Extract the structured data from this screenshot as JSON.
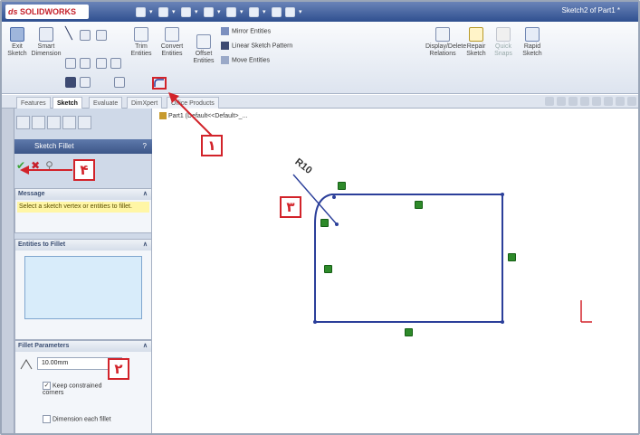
{
  "app": {
    "logo_text": "SOLIDWORKS",
    "document_title": "Sketch2 of Part1 *"
  },
  "ribbon": {
    "exit_sketch": "Exit Sketch",
    "smart_dimension": "Smart Dimension",
    "trim_entities": "Trim Entities",
    "convert_entities": "Convert Entities",
    "offset_entities": "Offset Entities",
    "mirror_entities": "Mirror Entities",
    "linear_sketch_pattern": "Linear Sketch Pattern",
    "move_entities": "Move Entities",
    "display_delete_relations": "Display/Delete Relations",
    "repair_sketch": "Repair Sketch",
    "quick_snaps": "Quick Snaps",
    "rapid_sketch": "Rapid Sketch"
  },
  "tabs": [
    "Features",
    "Sketch",
    "Evaluate",
    "DimXpert",
    "Office Products"
  ],
  "tree": {
    "label": "Part1 (Default<<Default>_..."
  },
  "property_manager": {
    "title": "Sketch Fillet",
    "message_header": "Message",
    "message_text": "Select a sketch vertex or entities to fillet.",
    "entities_header": "Entities to Fillet",
    "params_header": "Fillet Parameters",
    "radius_value": "10.00mm",
    "keep_constrained": "Keep constrained corners",
    "dimension_each": "Dimension each fillet"
  },
  "sketch": {
    "fillet_dimension": "R10"
  },
  "callouts": {
    "c1": "۱",
    "c2": "۲",
    "c3": "۳",
    "c4": "۴"
  },
  "colors": {
    "callout_red": "#d2232a",
    "sketch_line": "#2b3f9a",
    "relation_green": "#2e8a2a"
  }
}
